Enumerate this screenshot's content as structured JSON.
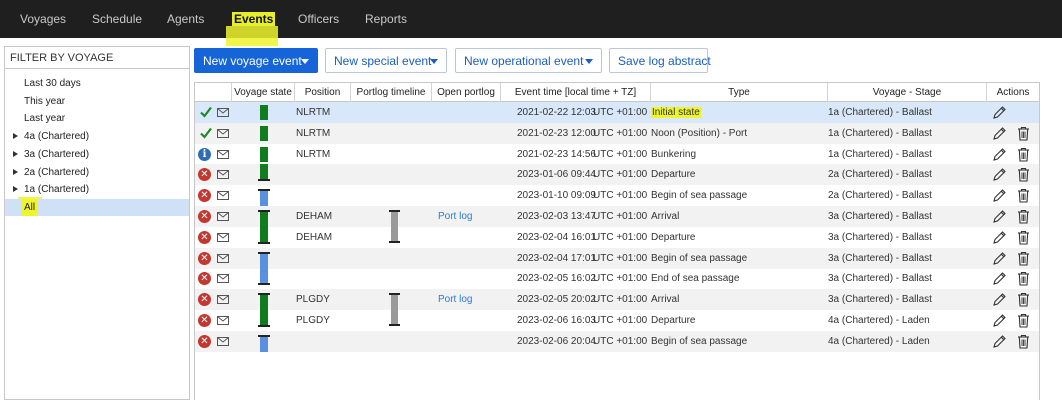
{
  "nav": {
    "items": [
      {
        "label": "Voyages",
        "active": false
      },
      {
        "label": "Schedule",
        "active": false
      },
      {
        "label": "Agents",
        "active": false
      },
      {
        "label": "Events",
        "active": true
      },
      {
        "label": "Officers",
        "active": false
      },
      {
        "label": "Reports",
        "active": false
      }
    ]
  },
  "sidebar": {
    "header": "FILTER BY VOYAGE",
    "items": [
      {
        "label": "Last 30 days",
        "expandable": false,
        "selected": false
      },
      {
        "label": "This year",
        "expandable": false,
        "selected": false
      },
      {
        "label": "Last year",
        "expandable": false,
        "selected": false
      },
      {
        "label": "4a (Chartered)",
        "expandable": true,
        "selected": false
      },
      {
        "label": "3a (Chartered)",
        "expandable": true,
        "selected": false
      },
      {
        "label": "2a (Chartered)",
        "expandable": true,
        "selected": false
      },
      {
        "label": "1a (Chartered)",
        "expandable": true,
        "selected": false
      },
      {
        "label": "All",
        "expandable": false,
        "selected": true
      }
    ]
  },
  "toolbar": {
    "new_voyage_event": "New voyage event",
    "new_special_event": "New special event",
    "new_operational_event": "New operational event",
    "save_log_abstract": "Save log abstract"
  },
  "table": {
    "columns": {
      "voyage_state": "Voyage state",
      "position": "Position",
      "portlog_timeline": "Portlog timeline",
      "open_portlog": "Open portlog",
      "event_time": "Event time [local time + TZ]",
      "type": "Type",
      "voyage_stage": "Voyage - Stage",
      "actions": "Actions"
    },
    "rows": [
      {
        "status": "check",
        "state": "green",
        "state_cap": "none",
        "position": "NLRTM",
        "portlog": "",
        "open_portlog": "",
        "time": "2021-02-22 12:03",
        "tz": "UTC +01:00",
        "type": "Initial state",
        "type_highlight": true,
        "stage": "1a (Chartered) - Ballast",
        "delete": false,
        "selected": true
      },
      {
        "status": "check",
        "state": "green",
        "state_cap": "none",
        "position": "NLRTM",
        "portlog": "",
        "open_portlog": "",
        "time": "2021-02-23 12:00",
        "tz": "UTC +01:00",
        "type": "Noon (Position) - Port",
        "type_highlight": false,
        "stage": "1a (Chartered) - Ballast",
        "delete": true,
        "selected": false
      },
      {
        "status": "info",
        "state": "green",
        "state_cap": "none",
        "position": "NLRTM",
        "portlog": "",
        "open_portlog": "",
        "time": "2021-02-23 14:56",
        "tz": "UTC +01:00",
        "type": "Bunkering",
        "type_highlight": false,
        "stage": "1a (Chartered) - Ballast",
        "delete": true,
        "selected": false
      },
      {
        "status": "error",
        "state": "green",
        "state_cap": "bottom",
        "position": "",
        "portlog": "",
        "open_portlog": "",
        "time": "2023-01-06 09:44",
        "tz": "UTC +01:00",
        "type": "Departure",
        "type_highlight": false,
        "stage": "2a (Chartered) - Ballast",
        "delete": true,
        "selected": false
      },
      {
        "status": "error",
        "state": "blue",
        "state_cap": "top",
        "position": "",
        "portlog": "",
        "open_portlog": "",
        "time": "2023-01-10 09:09",
        "tz": "UTC +01:00",
        "type": "Begin of sea passage",
        "type_highlight": false,
        "stage": "2a (Chartered) - Ballast",
        "delete": true,
        "selected": false
      },
      {
        "status": "error",
        "state": "green",
        "state_cap": "top",
        "position": "DEHAM",
        "portlog": "top",
        "open_portlog": "Port log",
        "time": "2023-02-03 13:47",
        "tz": "UTC +01:00",
        "type": "Arrival",
        "type_highlight": false,
        "stage": "3a (Chartered) - Ballast",
        "delete": true,
        "selected": false
      },
      {
        "status": "error",
        "state": "green",
        "state_cap": "bottom",
        "position": "DEHAM",
        "portlog": "bottom",
        "open_portlog": "",
        "time": "2023-02-04 16:01",
        "tz": "UTC +01:00",
        "type": "Departure",
        "type_highlight": false,
        "stage": "3a (Chartered) - Ballast",
        "delete": true,
        "selected": false
      },
      {
        "status": "error",
        "state": "blue",
        "state_cap": "top",
        "position": "",
        "portlog": "",
        "open_portlog": "",
        "time": "2023-02-04 17:01",
        "tz": "UTC +01:00",
        "type": "Begin of sea passage",
        "type_highlight": false,
        "stage": "3a (Chartered) - Ballast",
        "delete": true,
        "selected": false
      },
      {
        "status": "error",
        "state": "blue",
        "state_cap": "bottom",
        "position": "",
        "portlog": "",
        "open_portlog": "",
        "time": "2023-02-05 16:02",
        "tz": "UTC +01:00",
        "type": "End of sea passage",
        "type_highlight": false,
        "stage": "3a (Chartered) - Ballast",
        "delete": true,
        "selected": false
      },
      {
        "status": "error",
        "state": "green",
        "state_cap": "top",
        "position": "PLGDY",
        "portlog": "top",
        "open_portlog": "Port log",
        "time": "2023-02-05 20:02",
        "tz": "UTC +01:00",
        "type": "Arrival",
        "type_highlight": false,
        "stage": "3a (Chartered) - Ballast",
        "delete": true,
        "selected": false
      },
      {
        "status": "error",
        "state": "green",
        "state_cap": "bottom",
        "position": "PLGDY",
        "portlog": "bottom",
        "open_portlog": "",
        "time": "2023-02-06 16:03",
        "tz": "UTC +01:00",
        "type": "Departure",
        "type_highlight": false,
        "stage": "4a (Chartered) - Laden",
        "delete": true,
        "selected": false
      },
      {
        "status": "error",
        "state": "blue",
        "state_cap": "top",
        "position": "",
        "portlog": "",
        "open_portlog": "",
        "time": "2023-02-06 20:04",
        "tz": "UTC +01:00",
        "type": "Begin of sea passage",
        "type_highlight": false,
        "stage": "4a (Chartered) - Laden",
        "delete": true,
        "selected": false
      }
    ]
  },
  "colors": {
    "nav_bg": "#1f1f1f",
    "primary": "#1565d8",
    "highlight": "#eef52d",
    "state_green": "#0f7d1e",
    "state_blue": "#5b8fe0",
    "error_red": "#c5362f",
    "info_blue": "#2f6db5",
    "check_green": "#1a8a2a",
    "link": "#2a7bd6"
  }
}
